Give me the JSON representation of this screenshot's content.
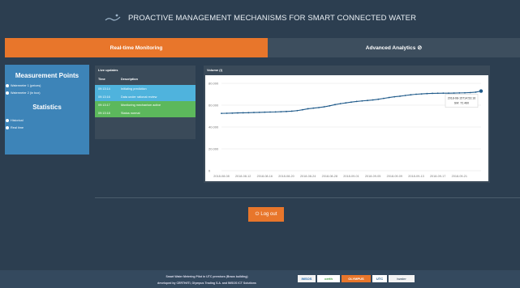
{
  "header": {
    "title": "PROACTIVE MANAGEMENT MECHANISMS FOR SMART CONNECTED WATER"
  },
  "tabs": [
    {
      "label": "Real-time Monitoring",
      "active": true
    },
    {
      "label": "Advanced Analytics",
      "icon": "check-circle-icon",
      "active": false
    }
  ],
  "sidebar": {
    "measurement_title": "Measurement Points",
    "measurement_items": [
      "Watermeter 1 (peices)",
      "Watermeter 2 (in box)"
    ],
    "statistics_title": "Statistics",
    "statistics_items": [
      "Historical",
      "Real time"
    ]
  },
  "live_updates": {
    "title": "Live updates",
    "columns": [
      "Time",
      "Description"
    ],
    "rows": [
      {
        "time": "09:13:14",
        "description": "Initiating prediction",
        "status": "blue"
      },
      {
        "time": "09:13:16",
        "description": "Data under rational review",
        "status": "blue"
      },
      {
        "time": "09:13:17",
        "description": "Monitoring mechanism active",
        "status": "green"
      },
      {
        "time": "09:13:18",
        "description": "Status normal",
        "status": "green"
      }
    ]
  },
  "volume_panel": {
    "title": "Volume (l)",
    "tooltip_line1": "2018-08-15T14:53:16",
    "tooltip_line2": "SM: 72.460"
  },
  "chart_data": {
    "type": "line",
    "title": "Volume (l)",
    "x": [
      "2018-08-08",
      "2018-08-09",
      "2018-08-10",
      "2018-08-11",
      "2018-08-12",
      "2018-08-13",
      "2018-08-14",
      "2018-08-15",
      "2018-08-16",
      "2018-08-17",
      "2018-08-18",
      "2018-08-19",
      "2018-08-20",
      "2018-08-21",
      "2018-08-22",
      "2018-08-23",
      "2018-08-24",
      "2018-08-25",
      "2018-08-26",
      "2018-08-27",
      "2018-08-28",
      "2018-08-29",
      "2018-08-30",
      "2018-08-31",
      "2018-09-01",
      "2018-09-02",
      "2018-09-03",
      "2018-09-04",
      "2018-09-05",
      "2018-09-06",
      "2018-09-07",
      "2018-09-08",
      "2018-09-09",
      "2018-09-10",
      "2018-09-11",
      "2018-09-12",
      "2018-09-13",
      "2018-09-14",
      "2018-09-15",
      "2018-09-16",
      "2018-09-17",
      "2018-09-18",
      "2018-09-19",
      "2018-09-20",
      "2018-09-21",
      "2018-09-22",
      "2018-09-23",
      "2018-09-24",
      "2018-09-25"
    ],
    "values": [
      52.5,
      52.6,
      52.7,
      52.9,
      53.0,
      53.1,
      53.3,
      53.4,
      53.6,
      53.7,
      53.8,
      54.0,
      54.2,
      54.5,
      55.0,
      55.8,
      56.7,
      57.3,
      57.8,
      58.5,
      59.4,
      60.5,
      61.4,
      62.1,
      62.8,
      63.4,
      63.9,
      64.3,
      64.8,
      65.4,
      66.2,
      67.0,
      67.7,
      68.2,
      68.9,
      69.5,
      70.0,
      70.3,
      70.6,
      70.8,
      70.9,
      71.0,
      71.0,
      71.1,
      71.2,
      71.3,
      71.5,
      71.9,
      72.9
    ],
    "xticks": [
      "2018-08-08",
      "2018-08-12",
      "2018-08-16",
      "2018-08-20",
      "2018-08-24",
      "2018-08-28",
      "2018-09-01",
      "2018-09-05",
      "2018-09-09",
      "2018-09-13",
      "2018-09-17",
      "2018-09-21"
    ],
    "yticks": [
      "0",
      "20.000",
      "40.000",
      "60.000",
      "80.000"
    ],
    "ylim": [
      0,
      80
    ],
    "grid": true,
    "color": "#1f5a8a"
  },
  "actions": {
    "logout_label": "Log out"
  },
  "footer": {
    "line1": "Smart Water Metering Pilot in UTC premises (Braos building)",
    "line2": "developed by CERTH/ITI, Olympus Trading S.A. and IMSOS ICT Solutions",
    "logos": [
      "IMSOS",
      "certh",
      "OLYMPUS",
      "UTC",
      "iwater"
    ]
  },
  "colors": {
    "accent": "#e8762b",
    "sidebar": "#3d84b8",
    "panel": "#3a4a59",
    "background": "#2c3e50"
  }
}
